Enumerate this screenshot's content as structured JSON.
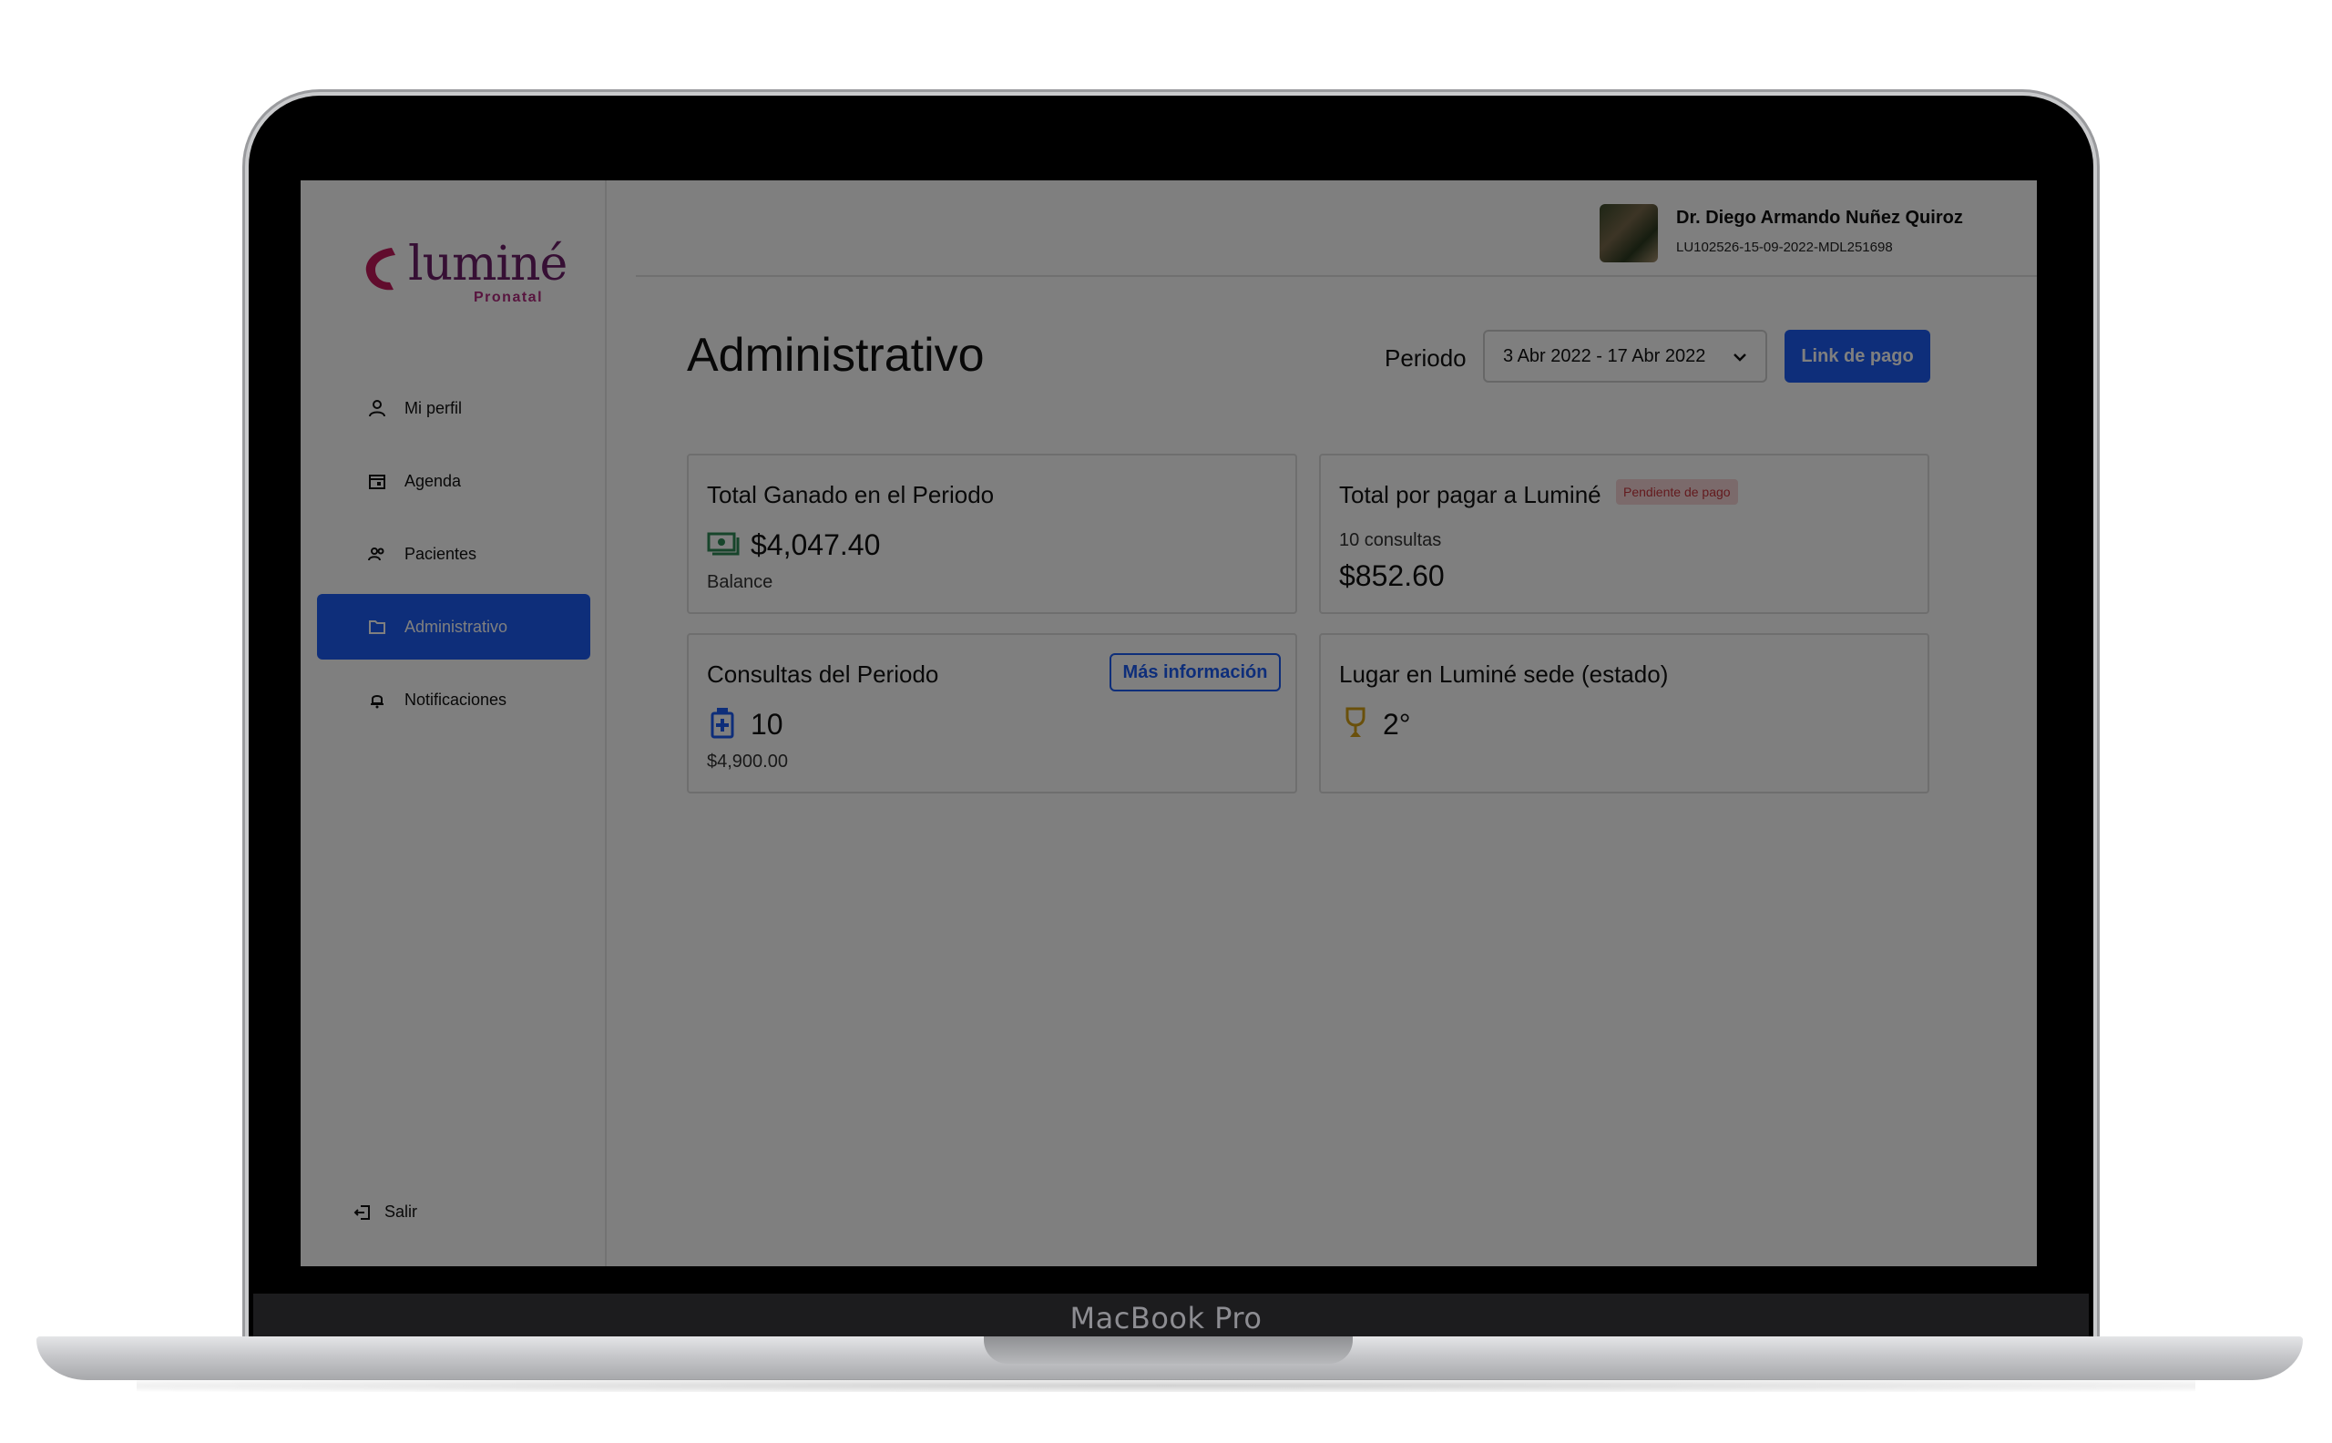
{
  "device": {
    "label": "MacBook Pro"
  },
  "sidebar": {
    "logo": {
      "text": "luminé",
      "sub": "Pronatal"
    },
    "items": [
      {
        "label": "Mi perfil",
        "icon": "user-icon",
        "active": false
      },
      {
        "label": "Agenda",
        "icon": "calendar-icon",
        "active": false
      },
      {
        "label": "Pacientes",
        "icon": "users-icon",
        "active": false
      },
      {
        "label": "Administrativo",
        "icon": "folder-icon",
        "active": true
      },
      {
        "label": "Notificaciones",
        "icon": "bell-icon",
        "active": false
      }
    ],
    "logout_label": "Salir"
  },
  "header": {
    "user_name": "Dr. Diego Armando Nuñez Quiroz",
    "user_id": "LU102526-15-09-2022-MDL251698"
  },
  "main": {
    "title": "Administrativo",
    "period_label": "Periodo",
    "period_value": "3 Abr 2022 - 17 Abr 2022",
    "pay_link_label": "Link de pago",
    "cards": {
      "earned": {
        "title": "Total Ganado en el Periodo",
        "value": "$4,047.40",
        "sub": "Balance"
      },
      "to_pay": {
        "title": "Total por pagar a Luminé",
        "badge": "Pendiente de pago",
        "consultations": "10 consultas",
        "value": "$852.60"
      },
      "consultations": {
        "title": "Consultas del Periodo",
        "button": "Más información",
        "value": "10",
        "sub": "$4,900.00"
      },
      "ranking": {
        "title": "Lugar en Luminé sede (estado)",
        "value": "2°"
      }
    }
  },
  "colors": {
    "primary": "#1d5df5",
    "brand": "#6d1f68",
    "money": "#2e8b57",
    "badge_text": "#c7343c",
    "trophy": "#d4a017"
  }
}
